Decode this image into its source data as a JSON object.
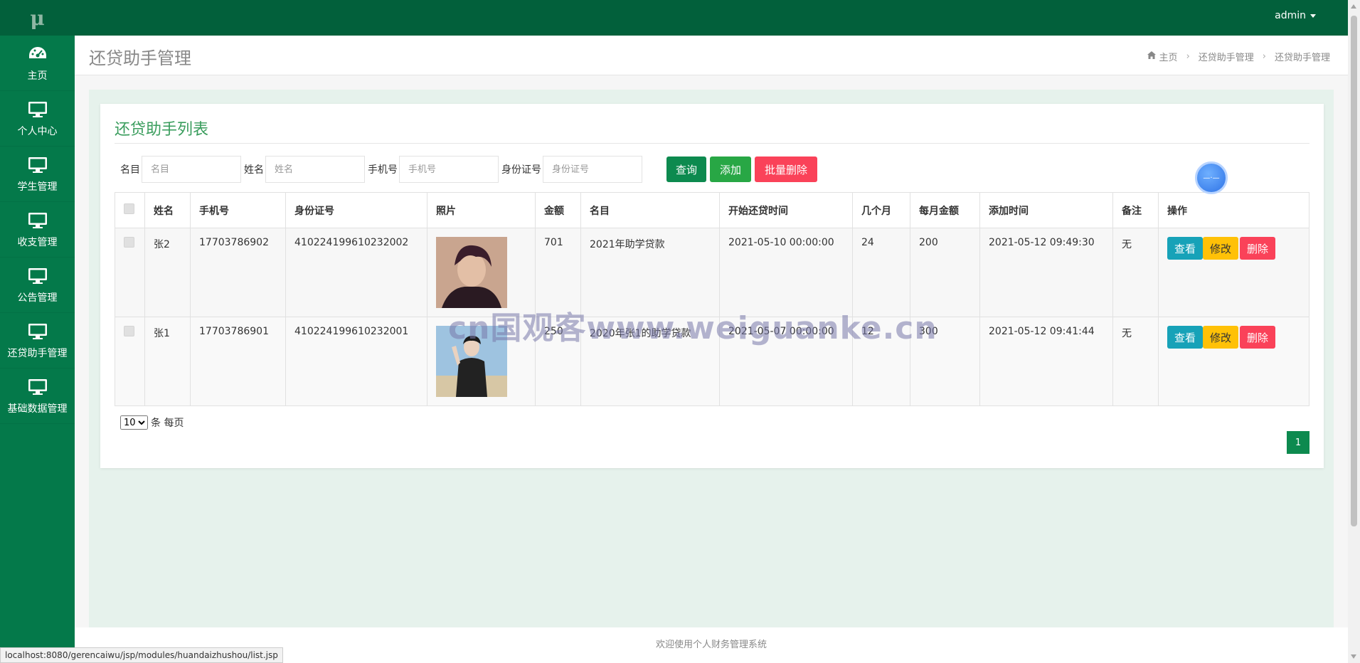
{
  "sidebar": {
    "logo": "μ",
    "items": [
      {
        "label": "主页",
        "icon": "dashboard-icon"
      },
      {
        "label": "个人中心",
        "icon": "monitor-icon"
      },
      {
        "label": "学生管理",
        "icon": "monitor-icon"
      },
      {
        "label": "收支管理",
        "icon": "monitor-icon"
      },
      {
        "label": "公告管理",
        "icon": "monitor-icon"
      },
      {
        "label": "还贷助手管理",
        "icon": "monitor-icon"
      },
      {
        "label": "基础数据管理",
        "icon": "monitor-icon"
      }
    ]
  },
  "topbar": {
    "user": "admin"
  },
  "header": {
    "title": "还贷助手管理",
    "breadcrumb": [
      "主页",
      "还贷助手管理",
      "还贷助手管理"
    ]
  },
  "panel": {
    "title": "还贷助手列表",
    "search": {
      "fields": [
        {
          "label": "名目",
          "placeholder": "名目"
        },
        {
          "label": "姓名",
          "placeholder": "姓名"
        },
        {
          "label": "手机号",
          "placeholder": "手机号"
        },
        {
          "label": "身份证号",
          "placeholder": "身份证号"
        }
      ],
      "query_label": "查询",
      "add_label": "添加",
      "batch_delete_label": "批量删除"
    },
    "table": {
      "columns": [
        "姓名",
        "手机号",
        "身份证号",
        "照片",
        "金额",
        "名目",
        "开始还贷时间",
        "几个月",
        "每月金额",
        "添加时间",
        "备注",
        "操作"
      ],
      "rows": [
        {
          "name": "张2",
          "phone": "17703786902",
          "id_card": "410224199610232002",
          "amount": "701",
          "item": "2021年助学贷款",
          "start": "2021-05-10 00:00:00",
          "months": "24",
          "monthly": "200",
          "added": "2021-05-12 09:49:30",
          "note": "无"
        },
        {
          "name": "张1",
          "phone": "17703786901",
          "id_card": "410224199610232001",
          "amount": "250",
          "item": "2020年张1的助学贷款",
          "start": "2021-05-07 00:00:00",
          "months": "12",
          "monthly": "300",
          "added": "2021-05-12 09:41:44",
          "note": "无"
        }
      ],
      "actions": {
        "view": "查看",
        "edit": "修改",
        "delete": "删除"
      }
    },
    "pager": {
      "page_size": "10",
      "page_size_suffix": "条 每页",
      "current_page": "1"
    }
  },
  "footer": {
    "text": "欢迎使用个人财务管理系统"
  },
  "status_url": "localhost:8080/gerencaiwu/jsp/modules/huandaizhushou/list.jsp",
  "watermark": "cn国观客www.weiguanke.cn",
  "colors": {
    "sidebar": "#04794a",
    "topbar": "#02603b",
    "accent": "#0d8a4f",
    "danger": "#fa4259",
    "warning": "#ffc107",
    "info": "#17a2b8"
  }
}
